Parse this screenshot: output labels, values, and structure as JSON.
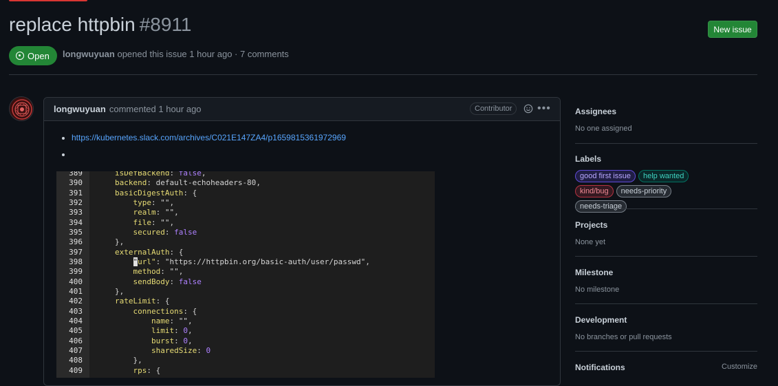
{
  "issue": {
    "title": "replace httpbin",
    "number": "#8911",
    "state": "Open",
    "author": "longwuyuan",
    "opened_text": "opened this issue 1 hour ago · 7 comments",
    "new_issue_label": "New issue"
  },
  "comment": {
    "author": "longwuyuan",
    "time_text": "commented 1 hour ago",
    "badge": "Contributor",
    "link": "https://kubernetes.slack.com/archives/C021E147ZA4/p1659815361972969",
    "code_lines": [
      {
        "n": "389",
        "indent": "            ",
        "key": "isDefBackend",
        "sep": ": ",
        "val": "false",
        "vtype": "n",
        "end": ","
      },
      {
        "n": "390",
        "indent": "            ",
        "key": "backend",
        "sep": ": ",
        "val": "default-echoheaders-80",
        "vtype": "s",
        "end": ","
      },
      {
        "n": "391",
        "indent": "            ",
        "key": "basicDigestAuth",
        "sep": ": ",
        "val": "{",
        "vtype": "s",
        "end": ""
      },
      {
        "n": "392",
        "indent": "                ",
        "key": "type",
        "sep": ": ",
        "val": "\"\"",
        "vtype": "s",
        "end": ","
      },
      {
        "n": "393",
        "indent": "                ",
        "key": "realm",
        "sep": ": ",
        "val": "\"\"",
        "vtype": "s",
        "end": ","
      },
      {
        "n": "394",
        "indent": "                ",
        "key": "file",
        "sep": ": ",
        "val": "\"\"",
        "vtype": "s",
        "end": ","
      },
      {
        "n": "395",
        "indent": "                ",
        "key": "secured",
        "sep": ": ",
        "val": "false",
        "vtype": "n",
        "end": ""
      },
      {
        "n": "396",
        "indent": "            ",
        "key": "",
        "sep": "",
        "val": "},",
        "vtype": "s",
        "end": ""
      },
      {
        "n": "397",
        "indent": "            ",
        "key": "externalAuth",
        "sep": ": ",
        "val": "{",
        "vtype": "s",
        "end": ""
      },
      {
        "n": "398",
        "indent": "                ",
        "key": "\"url\"",
        "sep": ": ",
        "val": "\"https://httpbin.org/basic-auth/user/passwd\"",
        "vtype": "s",
        "end": ",",
        "cursor": true
      },
      {
        "n": "399",
        "indent": "                ",
        "key": "method",
        "sep": ": ",
        "val": "\"\"",
        "vtype": "s",
        "end": ","
      },
      {
        "n": "400",
        "indent": "                ",
        "key": "sendBody",
        "sep": ": ",
        "val": "false",
        "vtype": "n",
        "end": ""
      },
      {
        "n": "401",
        "indent": "            ",
        "key": "",
        "sep": "",
        "val": "},",
        "vtype": "s",
        "end": ""
      },
      {
        "n": "402",
        "indent": "            ",
        "key": "rateLimit",
        "sep": ": ",
        "val": "{",
        "vtype": "s",
        "end": ""
      },
      {
        "n": "403",
        "indent": "                ",
        "key": "connections",
        "sep": ": ",
        "val": "{",
        "vtype": "s",
        "end": ""
      },
      {
        "n": "404",
        "indent": "                    ",
        "key": "name",
        "sep": ": ",
        "val": "\"\"",
        "vtype": "s",
        "end": ","
      },
      {
        "n": "405",
        "indent": "                    ",
        "key": "limit",
        "sep": ": ",
        "val": "0",
        "vtype": "n",
        "end": ","
      },
      {
        "n": "406",
        "indent": "                    ",
        "key": "burst",
        "sep": ": ",
        "val": "0",
        "vtype": "n",
        "end": ","
      },
      {
        "n": "407",
        "indent": "                    ",
        "key": "sharedSize",
        "sep": ": ",
        "val": "0",
        "vtype": "n",
        "end": ""
      },
      {
        "n": "408",
        "indent": "                ",
        "key": "",
        "sep": "",
        "val": "},",
        "vtype": "s",
        "end": ""
      },
      {
        "n": "409",
        "indent": "                ",
        "key": "rps",
        "sep": ": ",
        "val": "{",
        "vtype": "s",
        "end": ""
      }
    ]
  },
  "sidebar": {
    "assignees": {
      "title": "Assignees",
      "value": "No one assigned"
    },
    "labels": {
      "title": "Labels",
      "items": [
        {
          "text": "good first issue",
          "color": "#7057ff"
        },
        {
          "text": "help wanted",
          "color": "#008672"
        },
        {
          "text": "kind/bug",
          "color": "#d73a4a"
        },
        {
          "text": "needs-priority",
          "color": "#8b949e"
        },
        {
          "text": "needs-triage",
          "color": "#8b949e"
        }
      ]
    },
    "projects": {
      "title": "Projects",
      "value": "None yet"
    },
    "milestone": {
      "title": "Milestone",
      "value": "No milestone"
    },
    "development": {
      "title": "Development",
      "value": "No branches or pull requests"
    },
    "notifications": {
      "title": "Notifications",
      "action": "Customize"
    }
  },
  "colors": {
    "open": "#238636",
    "accent_link": "#58a6ff",
    "background": "#0d1117"
  },
  "icons": {
    "state": "issue-opened-icon",
    "reaction": "smiley-icon",
    "menu": "kebab-horizontal-icon"
  }
}
